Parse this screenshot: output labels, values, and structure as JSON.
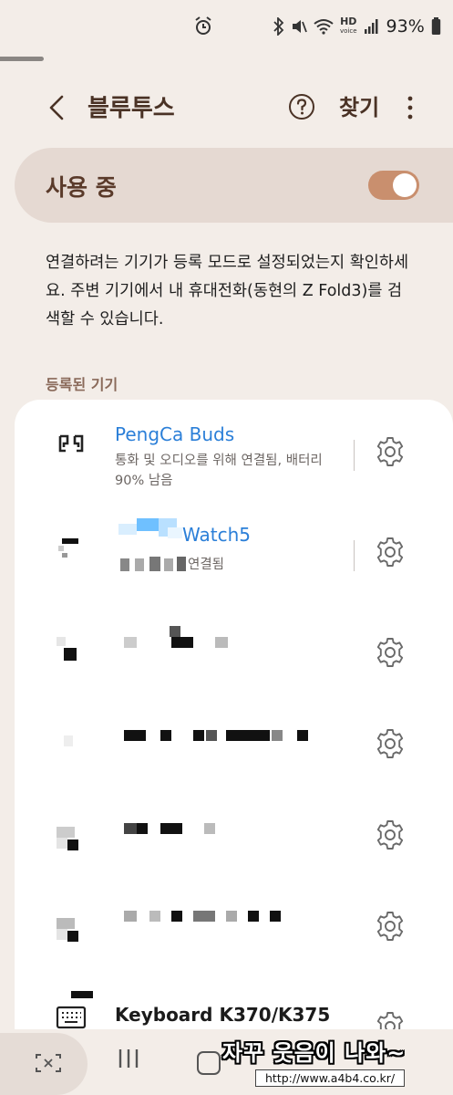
{
  "status_bar": {
    "battery": "93%",
    "icons": [
      "alarm-icon",
      "bluetooth-icon",
      "mute-icon",
      "wifi-icon",
      "hd-voice-icon",
      "signal-icon",
      "battery-icon"
    ],
    "hd_label": "HD",
    "voice_label": "voice"
  },
  "header": {
    "title": "블루투스",
    "find_label": "찾기"
  },
  "master": {
    "label": "사용 중",
    "enabled": true,
    "accent": "#c98f6e"
  },
  "description": "연결하려는 기기가 등록 모드로 설정되었는지 확인하세요. 주변 기기에서 내 휴대전화(동현의 Z Fold3)를 검색할 수 있습니다.",
  "section_header": "등록된 기기",
  "devices": [
    {
      "name": "PengCa Buds",
      "status": "통화 및 오디오를 위해 연결됨, 배터리 90% 남음",
      "icon": "earbuds-icon",
      "connected": true
    },
    {
      "name": "Watch5",
      "status": "연결됨",
      "icon": "watch-icon",
      "connected": true
    },
    {
      "name": "",
      "status": "",
      "icon": "device-icon",
      "connected": false
    },
    {
      "name": "",
      "status": "",
      "icon": "device-icon",
      "connected": false
    },
    {
      "name": "",
      "status": "",
      "icon": "device-icon",
      "connected": false
    },
    {
      "name": "",
      "status": "",
      "icon": "device-icon",
      "connected": false
    },
    {
      "name": "Keyboard K370/K375",
      "status": "",
      "icon": "keyboard-icon",
      "connected": false
    }
  ],
  "colors": {
    "link": "#2b7fd8",
    "title": "#4a3225",
    "background": "#f3ede8"
  },
  "watermark": {
    "text": "자꾸 웃음이 나와~",
    "url": "http://www.a4b4.co.kr/"
  }
}
